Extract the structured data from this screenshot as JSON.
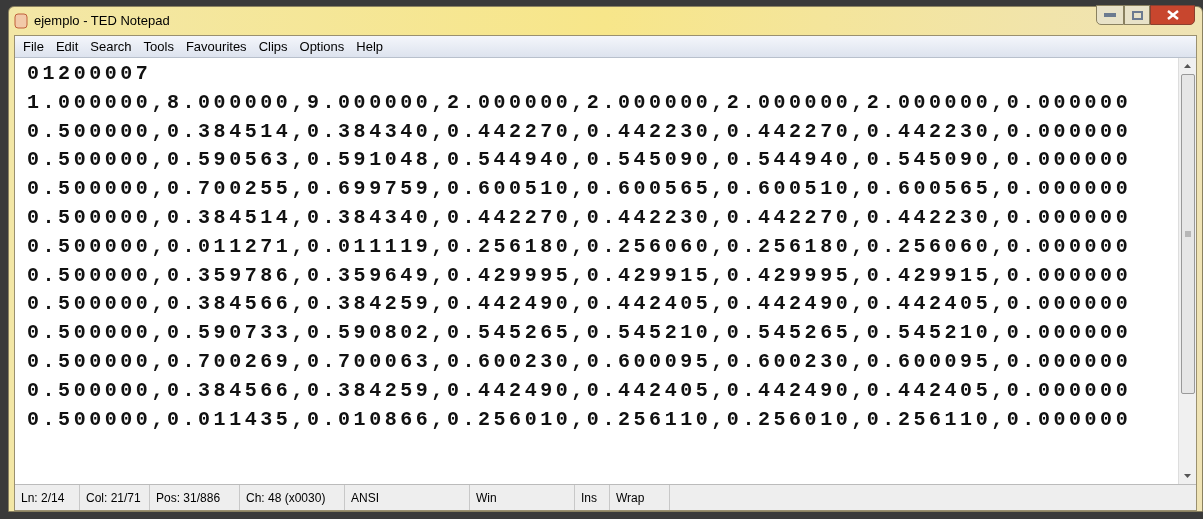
{
  "window": {
    "title": "ejemplo - TED Notepad"
  },
  "menu": [
    "File",
    "Edit",
    "Search",
    "Tools",
    "Favourites",
    "Clips",
    "Options",
    "Help"
  ],
  "editor": {
    "lines": [
      "01200007",
      "1.000000,8.000000,9.000000,2.000000,2.000000,2.000000,2.000000,0.000000",
      "0.500000,0.384514,0.384340,0.442270,0.442230,0.442270,0.442230,0.000000",
      "0.500000,0.590563,0.591048,0.544940,0.545090,0.544940,0.545090,0.000000",
      "0.500000,0.700255,0.699759,0.600510,0.600565,0.600510,0.600565,0.000000",
      "0.500000,0.384514,0.384340,0.442270,0.442230,0.442270,0.442230,0.000000",
      "0.500000,0.011271,0.011119,0.256180,0.256060,0.256180,0.256060,0.000000",
      "0.500000,0.359786,0.359649,0.429995,0.429915,0.429995,0.429915,0.000000",
      "0.500000,0.384566,0.384259,0.442490,0.442405,0.442490,0.442405,0.000000",
      "0.500000,0.590733,0.590802,0.545265,0.545210,0.545265,0.545210,0.000000",
      "0.500000,0.700269,0.700063,0.600230,0.600095,0.600230,0.600095,0.000000",
      "0.500000,0.384566,0.384259,0.442490,0.442405,0.442490,0.442405,0.000000",
      "0.500000,0.011435,0.010866,0.256010,0.256110,0.256010,0.256110,0.000000"
    ]
  },
  "status_bar": [
    "Ln: 2/14",
    "Col: 21/71",
    "Pos: 31/886",
    "Ch: 48 (x0030)",
    "ANSI",
    "Win",
    "Ins",
    "Wrap"
  ]
}
